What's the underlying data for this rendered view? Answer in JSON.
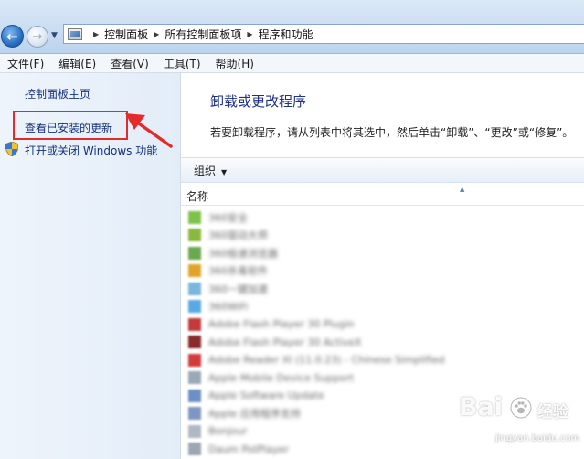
{
  "address_bar": {
    "breadcrumbs": [
      "控制面板",
      "所有控制面板项",
      "程序和功能"
    ],
    "separator": "▶"
  },
  "menu": [
    "文件(F)",
    "编辑(E)",
    "查看(V)",
    "工具(T)",
    "帮助(H)"
  ],
  "left_pane": {
    "home_link": "控制面板主页",
    "updates_link": "查看已安装的更新",
    "features_link": "打开或关闭 Windows 功能",
    "highlight_color": "#e32b2b"
  },
  "main": {
    "title": "卸载或更改程序",
    "description": "若要卸载程序，请从列表中将其选中，然后单击“卸载”、“更改”或“修复”。",
    "toolbar": {
      "organize_label": "组织",
      "organize_caret": "▼"
    },
    "column_name": "名称",
    "sort_arrow": "▲",
    "programs": [
      {
        "name": "360安全",
        "icon_color": "#7fc24b"
      },
      {
        "name": "360驱动大师",
        "icon_color": "#8ab93e"
      },
      {
        "name": "360极速浏览器",
        "icon_color": "#6aa84f"
      },
      {
        "name": "360杀毒软件",
        "icon_color": "#e0a42b"
      },
      {
        "name": "360一键加速",
        "icon_color": "#7ab7de"
      },
      {
        "name": "360WiFi",
        "icon_color": "#5aa9e6"
      },
      {
        "name": "Adobe Flash Player 30 Plugin",
        "icon_color": "#c23a3a"
      },
      {
        "name": "Adobe Flash Player 30 ActiveX",
        "icon_color": "#8a2b2b"
      },
      {
        "name": "Adobe Reader XI (11.0.23) - Chinese Simplified",
        "icon_color": "#d33b3b"
      },
      {
        "name": "Apple Mobile Device Support",
        "icon_color": "#9aa8b8"
      },
      {
        "name": "Apple Software Update",
        "icon_color": "#6c8fc6"
      },
      {
        "name": "Apple 应用程序支持",
        "icon_color": "#7e97c2"
      },
      {
        "name": "Bonjour",
        "icon_color": "#b0b8c4"
      },
      {
        "name": "Daum PotPlayer",
        "icon_color": "#9da7b3"
      }
    ]
  },
  "watermark": {
    "brand": "Bai",
    "brand_cn": "经验",
    "url": "jingyan.baidu.com"
  }
}
